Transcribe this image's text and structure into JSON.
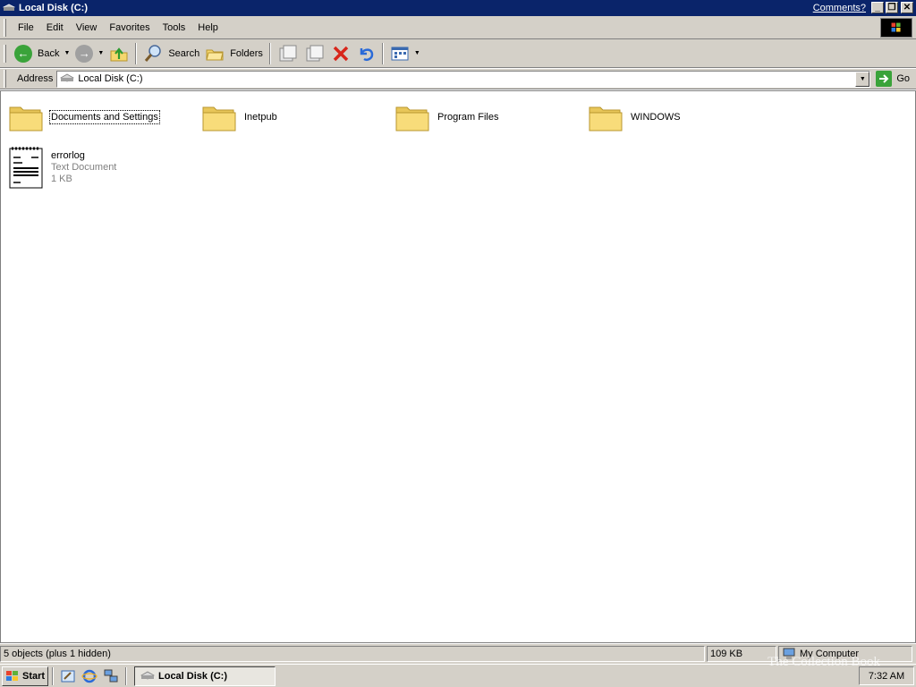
{
  "window": {
    "title": "Local Disk (C:)",
    "comments_link": "Comments?"
  },
  "menu": [
    "File",
    "Edit",
    "View",
    "Favorites",
    "Tools",
    "Help"
  ],
  "toolbar": {
    "back_label": "Back",
    "search_label": "Search",
    "folders_label": "Folders"
  },
  "address": {
    "label": "Address",
    "value": "Local Disk (C:)",
    "go_label": "Go"
  },
  "items": [
    {
      "name": "Documents and Settings",
      "type": "folder"
    },
    {
      "name": "Inetpub",
      "type": "folder"
    },
    {
      "name": "Program Files",
      "type": "folder"
    },
    {
      "name": "WINDOWS",
      "type": "folder"
    },
    {
      "name": "errorlog",
      "type": "Text Document",
      "size": "1 KB"
    }
  ],
  "status": {
    "objects": "5 objects (plus 1 hidden)",
    "size": "109 KB",
    "zone": "My Computer"
  },
  "taskbar": {
    "start": "Start",
    "task": "Local Disk (C:)",
    "clock": "7:32 AM"
  },
  "watermark": "The Collection Book",
  "colors": {
    "titlebar": "#0a246a",
    "chrome": "#d4d0c8",
    "folder": "#f5d76e"
  }
}
